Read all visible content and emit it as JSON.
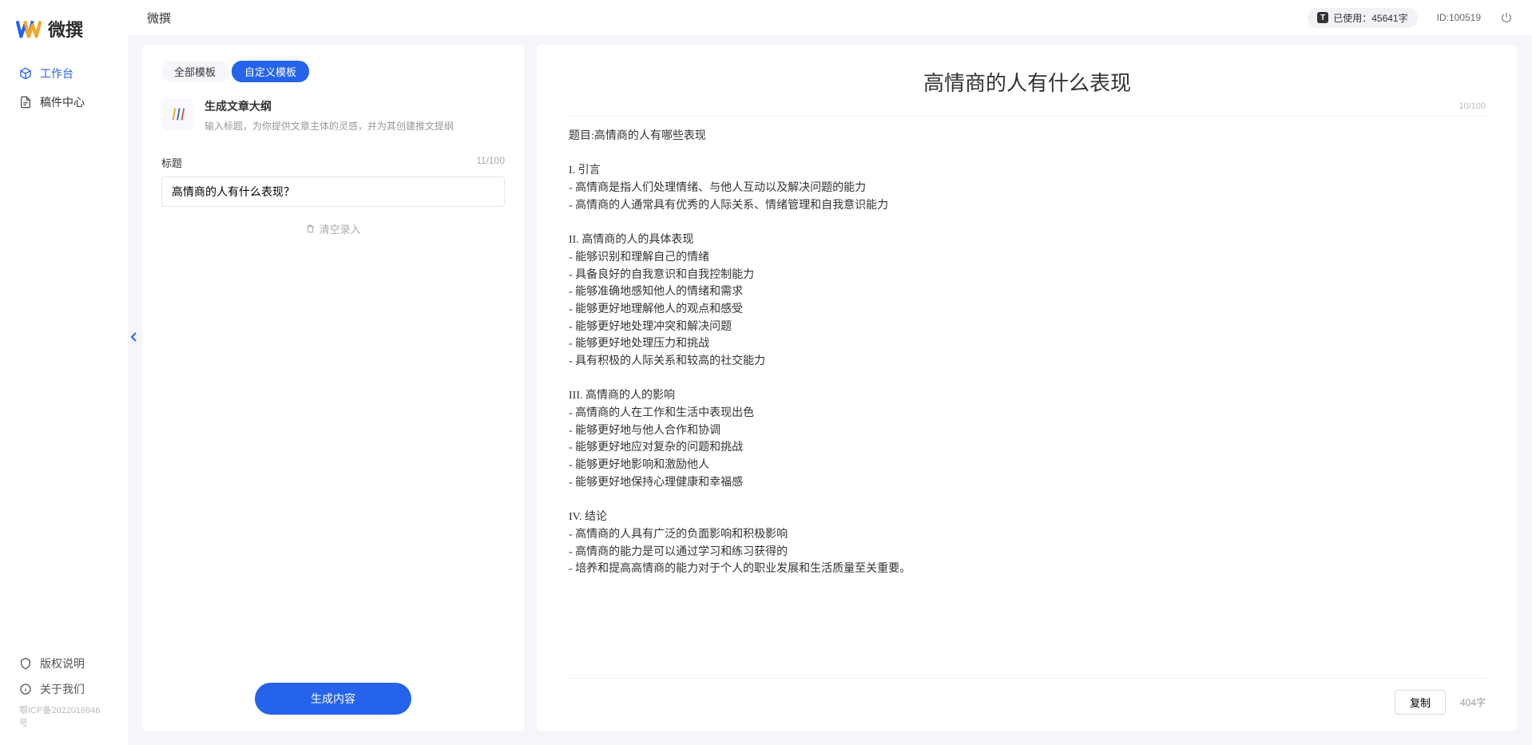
{
  "app": {
    "name": "微撰"
  },
  "topbar": {
    "title": "微撰",
    "usage_label": "已使用：45641字",
    "user_id": "ID:100519"
  },
  "sidebar": {
    "items": [
      {
        "label": "工作台",
        "active": true
      },
      {
        "label": "稿件中心",
        "active": false
      }
    ],
    "footer": [
      {
        "label": "版权说明"
      },
      {
        "label": "关于我们"
      }
    ],
    "icp": "鄂ICP备2022016946号"
  },
  "left_panel": {
    "tabs": [
      {
        "label": "全部模板",
        "active": false
      },
      {
        "label": "自定义模板",
        "active": true
      }
    ],
    "template": {
      "title": "生成文章大纲",
      "desc": "输入标题，为你提供文章主体的灵感，并为其创建推文提纲"
    },
    "field": {
      "label": "标题",
      "count": "11/100",
      "value": "高情商的人有什么表现？"
    },
    "clear_label": "清空录入",
    "generate_label": "生成内容"
  },
  "right_panel": {
    "title": "高情商的人有什么表现",
    "meta": "10/100",
    "body": "题目:高情商的人有哪些表现\n\nI. 引言\n- 高情商是指人们处理情绪、与他人互动以及解决问题的能力\n- 高情商的人通常具有优秀的人际关系、情绪管理和自我意识能力\n\nII. 高情商的人的具体表现\n- 能够识别和理解自己的情绪\n- 具备良好的自我意识和自我控制能力\n- 能够准确地感知他人的情绪和需求\n- 能够更好地理解他人的观点和感受\n- 能够更好地处理冲突和解决问题\n- 能够更好地处理压力和挑战\n- 具有积极的人际关系和较高的社交能力\n\nIII. 高情商的人的影响\n- 高情商的人在工作和生活中表现出色\n- 能够更好地与他人合作和协调\n- 能够更好地应对复杂的问题和挑战\n- 能够更好地影响和激励他人\n- 能够更好地保持心理健康和幸福感\n\nIV. 结论\n- 高情商的人具有广泛的负面影响和积极影响\n- 高情商的能力是可以通过学习和练习获得的\n- 培养和提高高情商的能力对于个人的职业发展和生活质量至关重要。",
    "copy_label": "复制",
    "word_count": "404字"
  }
}
